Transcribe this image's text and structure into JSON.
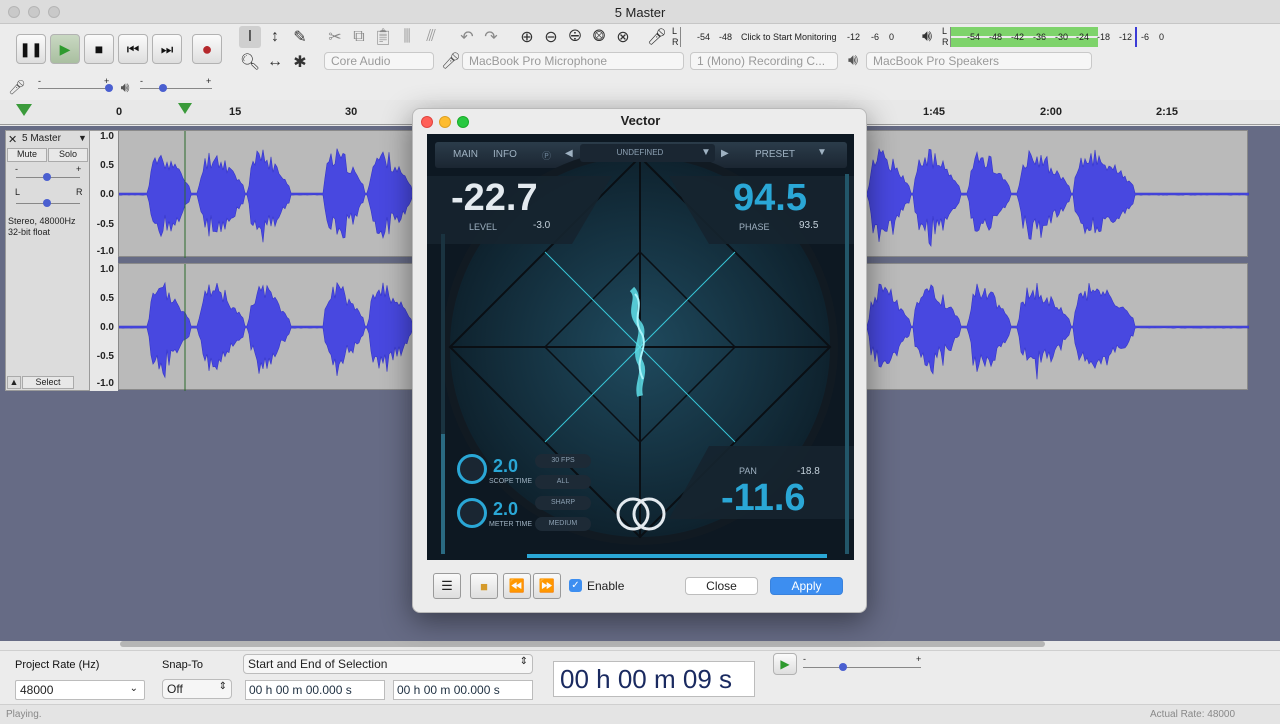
{
  "window": {
    "title": "5 Master"
  },
  "transport": {
    "pause": "❚❚",
    "play": "▶",
    "stop": "■",
    "skip_start": "⏮",
    "skip_end": "⏭",
    "record": "●"
  },
  "devices": {
    "host": "Core Audio",
    "input": "MacBook Pro Microphone",
    "channels": "1 (Mono) Recording C...",
    "output": "MacBook Pro Speakers"
  },
  "meters": {
    "record_ticks": [
      "-54",
      "-48",
      "Click to Start Monitoring",
      "-12",
      "-6",
      "0"
    ],
    "play_ticks": [
      "-54",
      "-48",
      "-42",
      "-36",
      "-30",
      "-24",
      "-18",
      "-12",
      "-6",
      "0"
    ],
    "record_L": "L",
    "record_R": "R",
    "play_L": "L",
    "play_R": "R"
  },
  "ruler": {
    "ticks": [
      "0",
      "15",
      "30",
      "1:45",
      "2:00",
      "2:15"
    ]
  },
  "track": {
    "name": "5 Master",
    "mute": "Mute",
    "solo": "Solo",
    "info1": "Stereo, 48000Hz",
    "info2": "32-bit float",
    "select": "Select",
    "gain_minus": "-",
    "gain_plus": "+",
    "pan_L": "L",
    "pan_R": "R",
    "scale": [
      "1.0",
      "0.5",
      "0.0",
      "-0.5",
      "-1.0"
    ]
  },
  "dialog": {
    "title": "Vector",
    "tabs": [
      "MAIN",
      "INFO"
    ],
    "preset_name": "UNDEFINED",
    "preset_label": "PRESET",
    "level_value": "-22.7",
    "level_label": "LEVEL",
    "level_sub": "-3.0",
    "phase_value": "94.5",
    "phase_label": "PHASE",
    "phase_sub": "93.5",
    "pan_label": "PAN",
    "pan_sub": "-18.8",
    "pan_value": "-11.6",
    "scope_time_value": "2.0",
    "scope_time_label": "SCOPE TIME",
    "meter_time_value": "2.0",
    "meter_time_label": "METER TIME",
    "option_fps": "30 FPS",
    "option_all": "ALL",
    "option_sharp": "SHARP",
    "option_medium": "MEDIUM",
    "enable_label": "Enable",
    "close_label": "Close",
    "apply_label": "Apply"
  },
  "selection_bar": {
    "project_rate_label": "Project Rate (Hz)",
    "project_rate_value": "48000",
    "snap_label": "Snap-To",
    "snap_value": "Off",
    "selection_mode": "Start and End of Selection",
    "start_time": "00 h 00 m 00.000 s",
    "end_time": "00 h 00 m 00.000 s",
    "big_time": "00 h 00 m 09 s"
  },
  "status": {
    "left": "Playing.",
    "right": "Actual Rate: 48000"
  },
  "colors": {
    "waveform": "#3b3bd6",
    "accent": "#2aa7d6",
    "apply": "#3d8ef0"
  }
}
